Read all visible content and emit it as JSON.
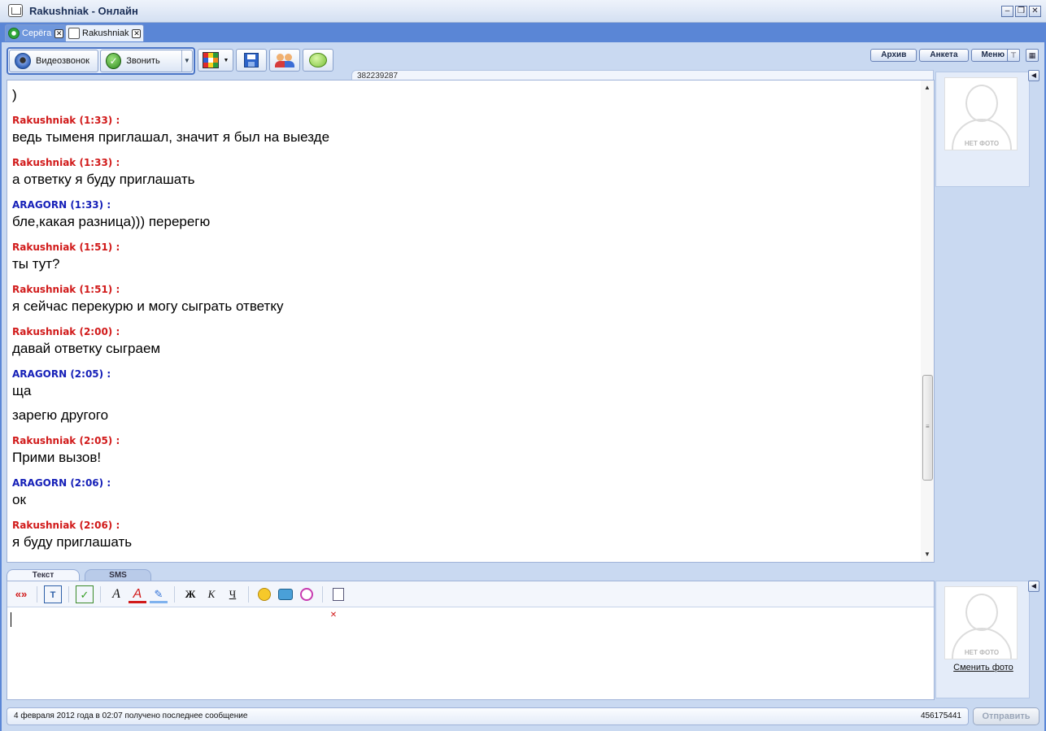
{
  "window": {
    "title": "Rakushniak - Онлайн"
  },
  "tabs": [
    {
      "label": "Серёга"
    },
    {
      "label": "Rakushniak"
    }
  ],
  "toolbar": {
    "video_call": "Видеозвонок",
    "call": "Звонить"
  },
  "top_buttons": {
    "archive": "Архив",
    "profile": "Анкета",
    "menu": "Меню"
  },
  "contact_id": "382239287",
  "chat": {
    "first_line": ")",
    "messages": [
      {
        "author": "Rakushniak (1:33) :",
        "color": "#d11a1a",
        "lines": [
          "ведь тыменя приглашал, значит я был на выезде"
        ]
      },
      {
        "author": "Rakushniak (1:33) :",
        "color": "#d11a1a",
        "lines": [
          "а ответку я буду приглашать"
        ]
      },
      {
        "author": "ARAGORN (1:33) :",
        "color": "#1620b8",
        "lines": [
          "бле,какая разница))) перерегю"
        ]
      },
      {
        "author": "Rakushniak (1:51) :",
        "color": "#d11a1a",
        "lines": [
          "ты тут?"
        ]
      },
      {
        "author": "Rakushniak (1:51) :",
        "color": "#d11a1a",
        "lines": [
          "я сейчас перекурю и могу сыграть ответку"
        ]
      },
      {
        "author": "Rakushniak (2:00) :",
        "color": "#d11a1a",
        "lines": [
          "давай ответку сыграем"
        ]
      },
      {
        "author": "ARAGORN (2:05) :",
        "color": "#1620b8",
        "lines": [
          "ща",
          "зарегю другого"
        ]
      },
      {
        "author": "Rakushniak (2:05) :",
        "color": "#d11a1a",
        "lines": [
          "Прими вызов!"
        ]
      },
      {
        "author": "ARAGORN (2:06) :",
        "color": "#1620b8",
        "lines": [
          "ок"
        ]
      },
      {
        "author": "Rakushniak (2:06) :",
        "color": "#d11a1a",
        "lines": [
          "я буду приглашать"
        ]
      }
    ]
  },
  "photo": {
    "no_photo": "НЕТ ФОТО",
    "change_photo": "Сменить фото"
  },
  "input_tabs": {
    "text": "Текст",
    "sms": "SMS"
  },
  "format_toolbar": {
    "bold": "Ж",
    "italic": "К",
    "underline": "Ч",
    "quote": "«»"
  },
  "status": {
    "last_message": "4 февраля 2012 года в 02:07 получено последнее сообщение",
    "own_id": "456175441",
    "send": "Отправить"
  }
}
